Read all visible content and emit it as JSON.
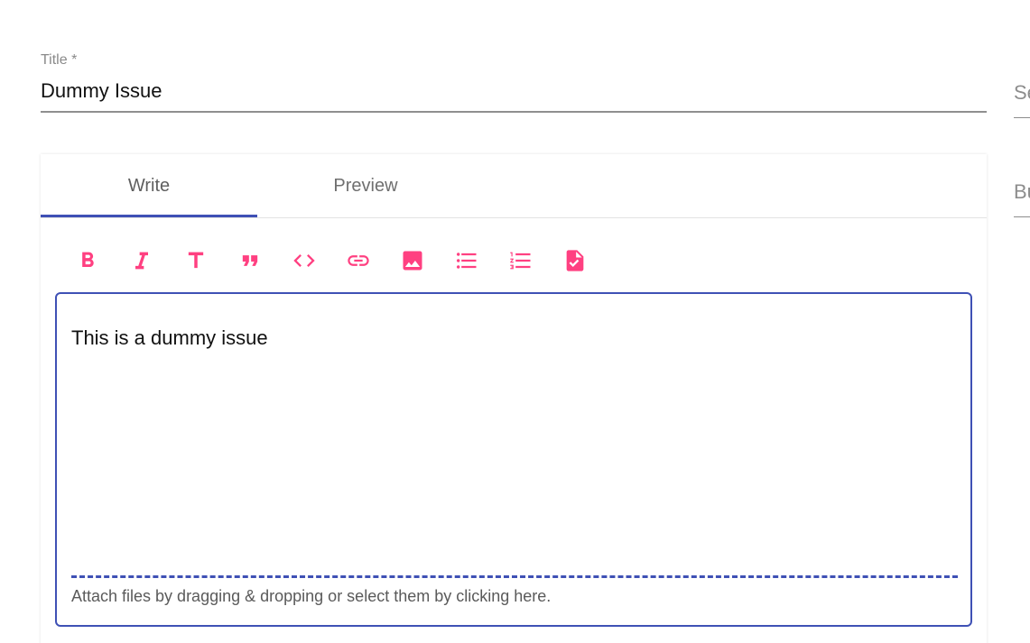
{
  "title_field": {
    "label": "Title *",
    "value": "Dummy Issue"
  },
  "side_fields": [
    {
      "label_visible": "Se"
    },
    {
      "label_visible": "Bu"
    }
  ],
  "editor": {
    "tabs": [
      {
        "label": "Write",
        "active": true
      },
      {
        "label": "Preview",
        "active": false
      }
    ],
    "toolbar": [
      {
        "icon": "bold-icon"
      },
      {
        "icon": "italic-icon"
      },
      {
        "icon": "heading-icon"
      },
      {
        "icon": "quote-icon"
      },
      {
        "icon": "code-icon"
      },
      {
        "icon": "link-icon"
      },
      {
        "icon": "image-icon"
      },
      {
        "icon": "bulleted-list-icon"
      },
      {
        "icon": "numbered-list-icon"
      },
      {
        "icon": "task-list-icon"
      }
    ],
    "content": "This is a dummy issue",
    "attach_text": "Attach files by dragging & dropping or select them by clicking here."
  },
  "colors": {
    "accent": "#3f51b5",
    "toolbar_icon": "#ff4081",
    "label": "#8a8a8a"
  }
}
